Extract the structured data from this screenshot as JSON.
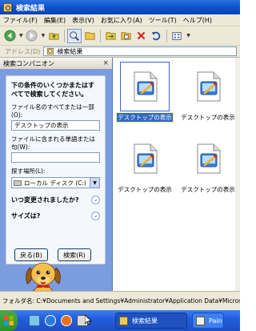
{
  "window": {
    "title": "検索結果"
  },
  "menu": [
    "ファイル(F)",
    "編集(E)",
    "表示(V)",
    "お気に入り(A)",
    "ツール(T)",
    "ヘルプ(H)"
  ],
  "toolbar": {
    "buttons": [
      "back-icon",
      "forward-icon",
      "up-folder-icon",
      "search-icon",
      "folders-icon",
      "move-to-icon",
      "copy-to-icon",
      "delete-icon",
      "undo-icon",
      "views-icon"
    ],
    "active": "search-icon"
  },
  "address": {
    "label": "アドレス(D)",
    "value": "検索結果"
  },
  "search_pane": {
    "title": "検索コンパニオン",
    "heading": "下の条件のいくつかまたはすべてで検索してください。",
    "filename_label": "ファイル名のすべてまたは一部(O):",
    "filename_value": "デスクトップの表示",
    "contains_label": "ファイルに含まれる単語または句(W):",
    "contains_value": "",
    "lookin_label": "探す場所(L):",
    "lookin_value": "ローカル ディスク (C:)",
    "when_modified": "いつ変更されましたか?",
    "size": "サイズは?",
    "back_button": "戻る(B)",
    "search_button": "検索(R)"
  },
  "results": [
    {
      "name": "デスクトップの表示",
      "selected": true
    },
    {
      "name": "デスクトップの表示",
      "selected": false
    },
    {
      "name": "デスクトップの表示",
      "selected": false
    },
    {
      "name": "デスクトップの表示",
      "selected": false
    }
  ],
  "status": {
    "text": "フォルダ名: C:¥Documents and Settings¥Administrator¥Application Data¥Microsoft¥Inte"
  },
  "taskbar": {
    "tasks": [
      {
        "label": "検索結果",
        "active": true
      },
      {
        "label": "Pain",
        "active": false
      }
    ]
  },
  "colors": {
    "title_bar": "#0a4ec8",
    "pane_background": "#7b9cde",
    "selection": "#316ac5",
    "taskbar": "#245edb"
  }
}
